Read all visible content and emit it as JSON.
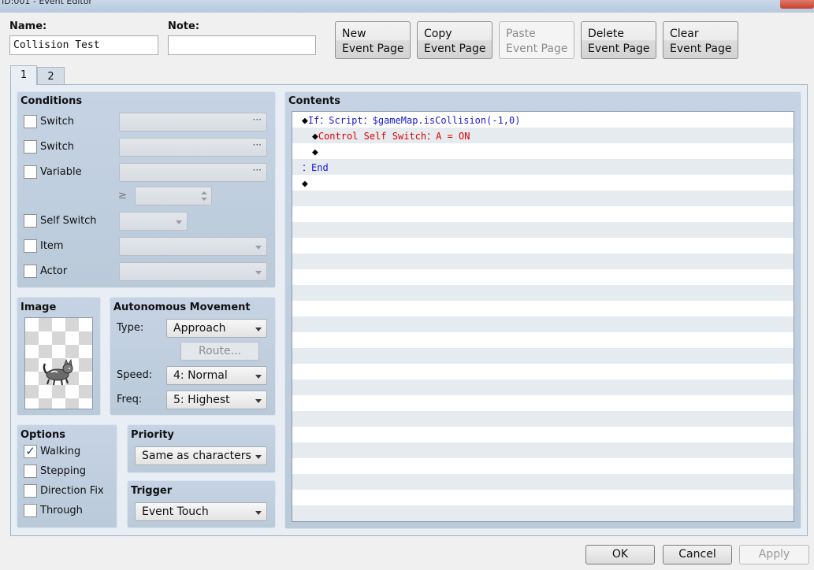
{
  "window": {
    "title": "ID:001 - Event Editor"
  },
  "header": {
    "name_label": "Name:",
    "name_value": "Collision Test",
    "note_label": "Note:",
    "note_value": "",
    "buttons": [
      {
        "line1": "New",
        "line2": "Event Page",
        "enabled": true
      },
      {
        "line1": "Copy",
        "line2": "Event Page",
        "enabled": true
      },
      {
        "line1": "Paste",
        "line2": "Event Page",
        "enabled": false
      },
      {
        "line1": "Delete",
        "line2": "Event Page",
        "enabled": true
      },
      {
        "line1": "Clear",
        "line2": "Event Page",
        "enabled": true
      }
    ]
  },
  "tabs": [
    {
      "label": "1",
      "active": true
    },
    {
      "label": "2",
      "active": false
    }
  ],
  "conditions": {
    "title": "Conditions",
    "switch1_label": "Switch",
    "switch1_checked": false,
    "switch2_label": "Switch",
    "switch2_checked": false,
    "variable_label": "Variable",
    "variable_checked": false,
    "ellipsis": "···",
    "gte_symbol": "≥",
    "self_switch_label": "Self Switch",
    "self_switch_checked": false,
    "item_label": "Item",
    "item_checked": false,
    "actor_label": "Actor",
    "actor_checked": false
  },
  "image": {
    "title": "Image",
    "sprite_icon": "cat-sprite"
  },
  "movement": {
    "title": "Autonomous Movement",
    "type_label": "Type:",
    "type_value": "Approach",
    "route_label": "Route...",
    "speed_label": "Speed:",
    "speed_value": "4: Normal",
    "freq_label": "Freq:",
    "freq_value": "5: Highest"
  },
  "options": {
    "title": "Options",
    "walking_label": "Walking",
    "walking_checked": true,
    "stepping_label": "Stepping",
    "stepping_checked": false,
    "direction_fix_label": "Direction Fix",
    "direction_fix_checked": false,
    "through_label": "Through",
    "through_checked": false,
    "check_mark": "✓"
  },
  "priority": {
    "title": "Priority",
    "value": "Same as characters"
  },
  "trigger": {
    "title": "Trigger",
    "value": "Event Touch"
  },
  "contents": {
    "title": "Contents",
    "diamond": "◆",
    "lines": {
      "if_keyword": "If",
      "if_rest": "：Script：$gameMap.isCollision(-1,0)",
      "control_self_switch": "Control Self Switch：A = ON",
      "end": "：End"
    }
  },
  "footer": {
    "ok": "OK",
    "cancel": "Cancel",
    "apply": "Apply"
  },
  "colors": {
    "command_blue": "#1a1ad6",
    "command_red": "#e00000",
    "panel": "#c6d3e4"
  }
}
